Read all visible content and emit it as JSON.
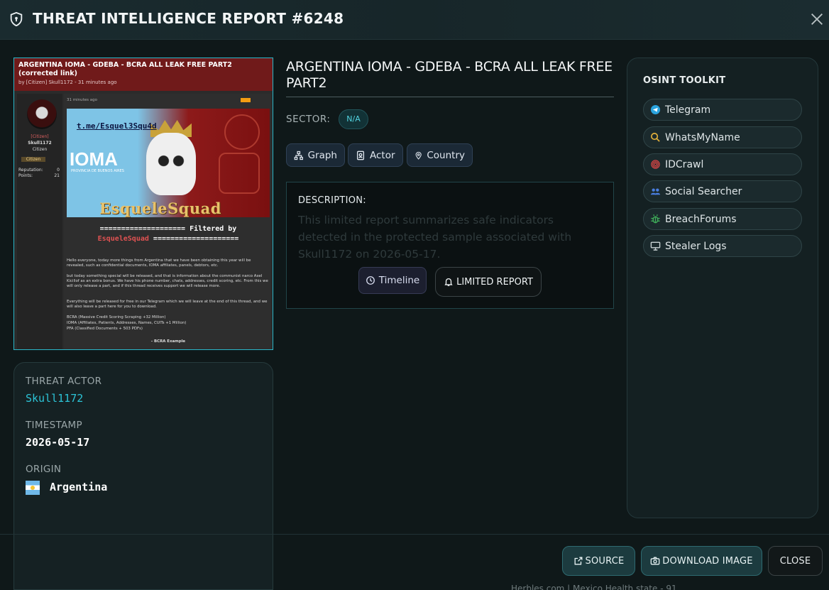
{
  "header": {
    "title": "THREAT INTELLIGENCE REPORT #6248",
    "icon": "shield-icon",
    "close_icon": "close-icon"
  },
  "screenshot": {
    "post_title": "ARGENTINA IOMA - GDEBA - BCRA ALL LEAK FREE PART2 (corrected link)",
    "post_meta": "by [Citizen] Skull1172 - 31 minutes ago",
    "user_rank": "[Citizen]",
    "username": "Skull1172",
    "user_role": "Citizen",
    "badge": "Citizen",
    "reputation_label": "Reputation:",
    "reputation_value": "0",
    "points_label": "Points:",
    "points_value": "21",
    "post_time": "31 minutes ago",
    "banner_link": "t.me/Esquel3Squ4d",
    "banner_ioma": "IOMA",
    "banner_ioma_sub": "PROVINCIA DE BUENOS AIRES",
    "banner_brand": "EsqueleSquad",
    "filtered_line1": "==================== Filtered by",
    "filtered_red": "EsqueleSquad",
    "filtered_line2": "====================",
    "body_1": "Hello everyone, today more things from Argentina that we have been obtaining this year will be revealed, such as confidential documents, IOMA affiliates, panels, debtors, etc.",
    "body_2": "but today something special will be released, and that is information about the communist narco Axel Kicillof as an extra bonus. We have his phone number, chats, addresses, credit scoring, etc. From this we will only release a part, and if this thread receives support we will release more.",
    "body_3": "Everything will be released for free in our Telegram which we will leave at the end of this thread, and we will also leave a part here for you to download.",
    "body_4": "BCRA (Massive Credit Scoring Scraping +32 Million)",
    "body_5": "IOMA (Affiliates, Patients, Addresses, Names, CUITs +1 Million)",
    "body_6": "PFA (Classified Documents + 503 PDFs)",
    "body_7": "- BCRA Example"
  },
  "info": {
    "actor_label": "THREAT ACTOR",
    "actor_value": "Skull1172",
    "timestamp_label": "TIMESTAMP",
    "timestamp_value": "2026-05-17",
    "origin_label": "ORIGIN",
    "origin_value": "Argentina"
  },
  "report": {
    "title": "ARGENTINA IOMA - GDEBA - BCRA ALL LEAK FREE PART2",
    "sector_label": "SECTOR:",
    "sector_value": "N/A",
    "pills": [
      "Graph",
      "Actor",
      "Country"
    ],
    "description_label": "DESCRIPTION:",
    "description_text": "This limited report summarizes safe indicators detected in the protected sample associated with Skull1172 on 2026-05-17.",
    "timeline_label": "Timeline",
    "limited_label": "LIMITED REPORT"
  },
  "toolkit": {
    "title": "OSINT TOOLKIT",
    "tools": [
      {
        "label": "Telegram",
        "icon": "telegram-icon",
        "color": "#2aa3de"
      },
      {
        "label": "WhatsMyName",
        "icon": "search-icon",
        "color": "#e2b03a"
      },
      {
        "label": "IDCrawl",
        "icon": "fingerprint-icon",
        "color": "#d94545"
      },
      {
        "label": "Social Searcher",
        "icon": "users-icon",
        "color": "#4a7ee0"
      },
      {
        "label": "BreachForums",
        "icon": "bug-icon",
        "color": "#3fae5a"
      },
      {
        "label": "Stealer Logs",
        "icon": "terminal-icon",
        "color": "#c9d2d4"
      }
    ]
  },
  "footer": {
    "source_label": "SOURCE",
    "download_label": "DOWNLOAD IMAGE",
    "close_label": "CLOSE",
    "ghost_text": "Herbles.com | Mexico Health state - 91"
  },
  "colors": {
    "accent": "#2cc3d6",
    "background": "#0f1819",
    "banner_red": "#701a1a"
  }
}
